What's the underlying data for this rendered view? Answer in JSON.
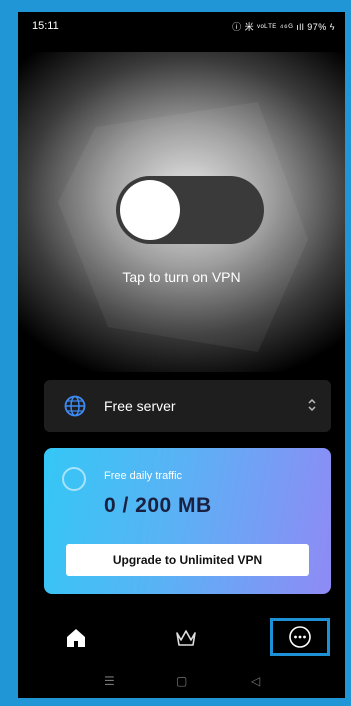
{
  "status_bar": {
    "time": "15:11",
    "icons_text": "ⓘ 米 ᵛᵒᴸᵀᴱ ⁴⁶ᴳ ıll 97% ϟ"
  },
  "vpn": {
    "tap_label": "Tap to turn on VPN",
    "connected": false
  },
  "server": {
    "label": "Free server",
    "icon": "globe-icon"
  },
  "traffic": {
    "label": "Free daily traffic",
    "value": "0 / 200 MB",
    "upgrade_label": "Upgrade to Unlimited VPN"
  },
  "nav": {
    "items": [
      {
        "icon": "home-icon",
        "active": true
      },
      {
        "icon": "crown-icon",
        "active": false
      },
      {
        "icon": "more-icon",
        "active": false,
        "highlighted": true
      }
    ]
  },
  "system_nav": {
    "menu": "☰",
    "home": "▢",
    "back": "◁"
  },
  "colors": {
    "accent": "#1e90d6",
    "gradient_start": "#34c7f5",
    "gradient_end": "#8f8af5",
    "background": "#000000"
  }
}
